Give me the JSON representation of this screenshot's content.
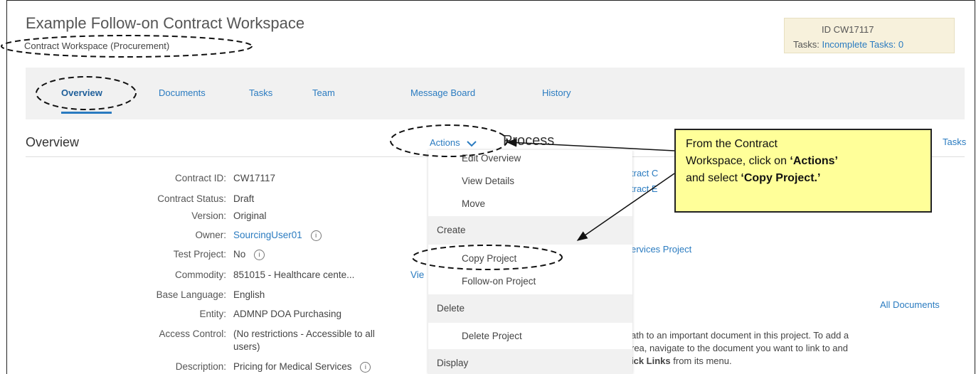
{
  "header": {
    "title": "Example Follow-on Contract Workspace",
    "subtitle": "Contract Workspace (Procurement)",
    "id_label": "ID CW17117",
    "tasks_label": "Tasks:",
    "tasks_link": "Incomplete Tasks: 0"
  },
  "tabs": [
    "Overview",
    "Documents",
    "Tasks",
    "Team",
    "Message Board",
    "History"
  ],
  "section": {
    "overview_heading": "Overview",
    "actions_label": "Actions",
    "process_heading": "Process",
    "tasks_link": "Tasks"
  },
  "fields": [
    {
      "label": "Contract ID:",
      "value": "CW17117"
    },
    {
      "label": "Contract Status:",
      "value": "Draft"
    },
    {
      "label": "Version:",
      "value": "Original"
    },
    {
      "label": "Owner:",
      "value": "SourcingUser01"
    },
    {
      "label": "Test Project:",
      "value": "No"
    },
    {
      "label": "Commodity:",
      "value": "851015 - Healthcare cente...",
      "extra": "Vie"
    },
    {
      "label": "Base Language:",
      "value": "English"
    },
    {
      "label": "Entity:",
      "value": "ADMNP DOA Purchasing"
    },
    {
      "label": "Access Control:",
      "value": "(No restrictions - Accessible to all",
      "value2": "users)"
    },
    {
      "label": "Description:",
      "value": "Pricing for Medical Services"
    }
  ],
  "menu": {
    "items_top": [
      "Edit Overview",
      "View Details",
      "Move"
    ],
    "group_create": "Create",
    "items_create": [
      "Copy Project",
      "Follow-on Project"
    ],
    "group_delete": "Delete",
    "items_delete": [
      "Delete Project"
    ],
    "group_display": "Display"
  },
  "right_partial": {
    "line1": "tract C",
    "line2": "tract E",
    "services_project": "ervices Project",
    "all_documents": "All Documents",
    "doc_text1": "ath to an important document in this project. To add a",
    "doc_text2": "rea, navigate to the document you want to link to and",
    "doc_text3_bold": "ick Links",
    "doc_text3_rest": " from its menu."
  },
  "callout": {
    "text1": "From the Contract",
    "text2": "Workspace, click on ",
    "bold1": "‘Actions’",
    "text3": "and select ",
    "bold2": "‘Copy Project.’"
  },
  "colors": {
    "link": "#2a7bc0",
    "callout_bg": "#ffff99",
    "tabbar_bg": "#f1f1f1",
    "id_box_bg": "#f7f1dc"
  }
}
